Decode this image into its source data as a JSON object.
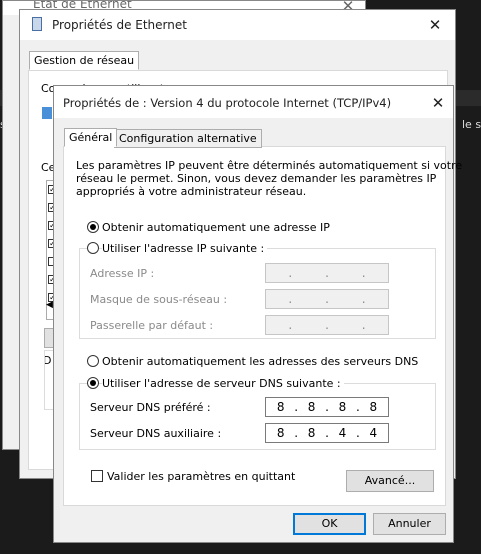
{
  "status_window": {
    "title": "État de Ethernet"
  },
  "ethernet_props": {
    "title": "Propriétés de Ethernet",
    "tab": "Gestion de réseau",
    "connect_label": "Connexion en utilisant :",
    "items_label": "Ce",
    "bg_right_text": "le s",
    "bg_left_text": "s"
  },
  "ipv4": {
    "title": "Propriétés de : Version 4 du protocole Internet (TCP/IPv4)",
    "tabs": [
      "Général",
      "Configuration alternative"
    ],
    "intro": [
      "Les paramètres IP peuvent être déterminés automatiquement si votre",
      "réseau le permet. Sinon, vous devez demander les paramètres IP",
      "appropriés à votre administrateur réseau."
    ],
    "ip_auto": "Obtenir automatiquement une adresse IP",
    "ip_manual": "Utiliser l'adresse IP suivante :",
    "ip_fields": [
      "Adresse IP :",
      "Masque de sous-réseau :",
      "Passerelle par défaut :"
    ],
    "empty_ip": [
      ".",
      ".",
      "."
    ],
    "dns_auto": "Obtenir automatiquement les adresses des serveurs DNS",
    "dns_manual": "Utiliser l'adresse de serveur DNS suivante :",
    "dns_preferred_label": "Serveur DNS préféré :",
    "dns_preferred": [
      "8",
      ".",
      "8",
      ".",
      "8",
      ".",
      "8"
    ],
    "dns_alt_label": "Serveur DNS auxiliaire :",
    "dns_alt": [
      "8",
      ".",
      "8",
      ".",
      "4",
      ".",
      "4"
    ],
    "validate": "Valider les paramètres en quittant",
    "advanced": "Avancé...",
    "ok": "OK",
    "cancel": "Annuler"
  }
}
